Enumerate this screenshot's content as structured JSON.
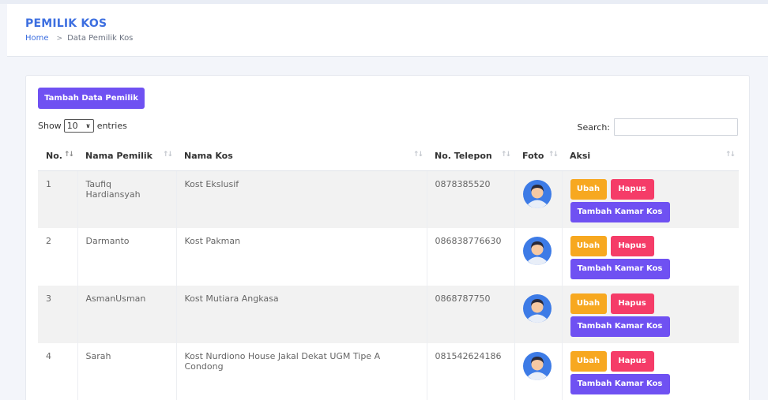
{
  "header": {
    "title": "PEMILIK KOS",
    "breadcrumb": {
      "home": "Home",
      "separator": ">",
      "current": "Data Pemilik Kos"
    }
  },
  "toolbar": {
    "add_label": "Tambah Data Pemilik"
  },
  "entries": {
    "show_label": "Show",
    "selected": "10",
    "suffix": "entries"
  },
  "search": {
    "label": "Search:",
    "value": ""
  },
  "table": {
    "columns": [
      "No.",
      "Nama Pemilik",
      "Nama Kos",
      "No. Telepon",
      "Foto",
      "Aksi"
    ],
    "rows": [
      {
        "no": "1",
        "nama": "Taufiq Hardiansyah",
        "kos": "Kost Ekslusif",
        "telepon": "0878385520"
      },
      {
        "no": "2",
        "nama": "Darmanto",
        "kos": "Kost Pakman",
        "telepon": "086838776630"
      },
      {
        "no": "3",
        "nama": "AsmanUsman",
        "kos": "Kost Mutiara Angkasa",
        "telepon": "0868787750"
      },
      {
        "no": "4",
        "nama": "Sarah",
        "kos": "Kost Nurdiono House Jakal Dekat UGM Tipe A Condong",
        "telepon": "081542624186"
      }
    ]
  },
  "actions": {
    "edit": "Ubah",
    "delete": "Hapus",
    "add_room": "Tambah Kamar Kos"
  },
  "colors": {
    "primary": "#6f51f2",
    "edit": "#f7a820",
    "delete": "#f53c68",
    "title": "#3d6fe0"
  },
  "icons": {
    "avatar": "user-avatar-icon",
    "sort": "sort-arrows-icon",
    "dropdown": "chevron-down-icon"
  }
}
